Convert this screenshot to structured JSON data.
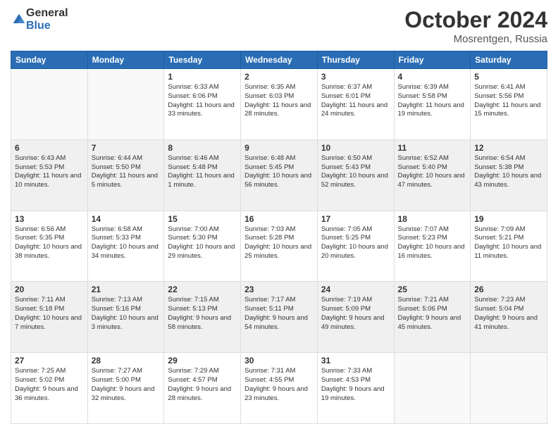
{
  "logo": {
    "general": "General",
    "blue": "Blue"
  },
  "title": "October 2024",
  "location": "Mosrentgen, Russia",
  "days_header": [
    "Sunday",
    "Monday",
    "Tuesday",
    "Wednesday",
    "Thursday",
    "Friday",
    "Saturday"
  ],
  "weeks": [
    [
      {
        "day": "",
        "text": ""
      },
      {
        "day": "",
        "text": ""
      },
      {
        "day": "1",
        "text": "Sunrise: 6:33 AM\nSunset: 6:06 PM\nDaylight: 11 hours\nand 33 minutes."
      },
      {
        "day": "2",
        "text": "Sunrise: 6:35 AM\nSunset: 6:03 PM\nDaylight: 11 hours\nand 28 minutes."
      },
      {
        "day": "3",
        "text": "Sunrise: 6:37 AM\nSunset: 6:01 PM\nDaylight: 11 hours\nand 24 minutes."
      },
      {
        "day": "4",
        "text": "Sunrise: 6:39 AM\nSunset: 5:58 PM\nDaylight: 11 hours\nand 19 minutes."
      },
      {
        "day": "5",
        "text": "Sunrise: 6:41 AM\nSunset: 5:56 PM\nDaylight: 11 hours\nand 15 minutes."
      }
    ],
    [
      {
        "day": "6",
        "text": "Sunrise: 6:43 AM\nSunset: 5:53 PM\nDaylight: 11 hours\nand 10 minutes."
      },
      {
        "day": "7",
        "text": "Sunrise: 6:44 AM\nSunset: 5:50 PM\nDaylight: 11 hours\nand 5 minutes."
      },
      {
        "day": "8",
        "text": "Sunrise: 6:46 AM\nSunset: 5:48 PM\nDaylight: 11 hours\nand 1 minute."
      },
      {
        "day": "9",
        "text": "Sunrise: 6:48 AM\nSunset: 5:45 PM\nDaylight: 10 hours\nand 56 minutes."
      },
      {
        "day": "10",
        "text": "Sunrise: 6:50 AM\nSunset: 5:43 PM\nDaylight: 10 hours\nand 52 minutes."
      },
      {
        "day": "11",
        "text": "Sunrise: 6:52 AM\nSunset: 5:40 PM\nDaylight: 10 hours\nand 47 minutes."
      },
      {
        "day": "12",
        "text": "Sunrise: 6:54 AM\nSunset: 5:38 PM\nDaylight: 10 hours\nand 43 minutes."
      }
    ],
    [
      {
        "day": "13",
        "text": "Sunrise: 6:56 AM\nSunset: 5:35 PM\nDaylight: 10 hours\nand 38 minutes."
      },
      {
        "day": "14",
        "text": "Sunrise: 6:58 AM\nSunset: 5:33 PM\nDaylight: 10 hours\nand 34 minutes."
      },
      {
        "day": "15",
        "text": "Sunrise: 7:00 AM\nSunset: 5:30 PM\nDaylight: 10 hours\nand 29 minutes."
      },
      {
        "day": "16",
        "text": "Sunrise: 7:03 AM\nSunset: 5:28 PM\nDaylight: 10 hours\nand 25 minutes."
      },
      {
        "day": "17",
        "text": "Sunrise: 7:05 AM\nSunset: 5:25 PM\nDaylight: 10 hours\nand 20 minutes."
      },
      {
        "day": "18",
        "text": "Sunrise: 7:07 AM\nSunset: 5:23 PM\nDaylight: 10 hours\nand 16 minutes."
      },
      {
        "day": "19",
        "text": "Sunrise: 7:09 AM\nSunset: 5:21 PM\nDaylight: 10 hours\nand 11 minutes."
      }
    ],
    [
      {
        "day": "20",
        "text": "Sunrise: 7:11 AM\nSunset: 5:18 PM\nDaylight: 10 hours\nand 7 minutes."
      },
      {
        "day": "21",
        "text": "Sunrise: 7:13 AM\nSunset: 5:16 PM\nDaylight: 10 hours\nand 3 minutes."
      },
      {
        "day": "22",
        "text": "Sunrise: 7:15 AM\nSunset: 5:13 PM\nDaylight: 9 hours\nand 58 minutes."
      },
      {
        "day": "23",
        "text": "Sunrise: 7:17 AM\nSunset: 5:11 PM\nDaylight: 9 hours\nand 54 minutes."
      },
      {
        "day": "24",
        "text": "Sunrise: 7:19 AM\nSunset: 5:09 PM\nDaylight: 9 hours\nand 49 minutes."
      },
      {
        "day": "25",
        "text": "Sunrise: 7:21 AM\nSunset: 5:06 PM\nDaylight: 9 hours\nand 45 minutes."
      },
      {
        "day": "26",
        "text": "Sunrise: 7:23 AM\nSunset: 5:04 PM\nDaylight: 9 hours\nand 41 minutes."
      }
    ],
    [
      {
        "day": "27",
        "text": "Sunrise: 7:25 AM\nSunset: 5:02 PM\nDaylight: 9 hours\nand 36 minutes."
      },
      {
        "day": "28",
        "text": "Sunrise: 7:27 AM\nSunset: 5:00 PM\nDaylight: 9 hours\nand 32 minutes."
      },
      {
        "day": "29",
        "text": "Sunrise: 7:29 AM\nSunset: 4:57 PM\nDaylight: 9 hours\nand 28 minutes."
      },
      {
        "day": "30",
        "text": "Sunrise: 7:31 AM\nSunset: 4:55 PM\nDaylight: 9 hours\nand 23 minutes."
      },
      {
        "day": "31",
        "text": "Sunrise: 7:33 AM\nSunset: 4:53 PM\nDaylight: 9 hours\nand 19 minutes."
      },
      {
        "day": "",
        "text": ""
      },
      {
        "day": "",
        "text": ""
      }
    ]
  ]
}
